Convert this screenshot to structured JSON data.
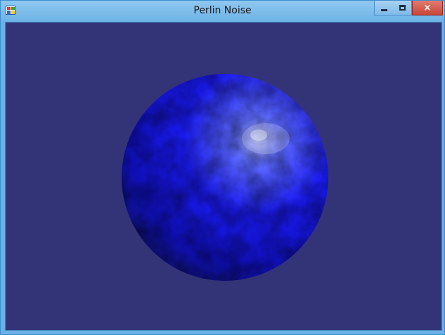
{
  "window": {
    "title": "Perlin Noise",
    "controls": {
      "minimize": "minimize",
      "maximize": "maximize",
      "close": "×"
    }
  },
  "icons": {
    "app": "app-icon",
    "minimize": "minimize-icon",
    "maximize": "maximize-icon",
    "close": "close-icon"
  },
  "colors": {
    "client_background": "#333378",
    "sphere_highlight": "#5f6dff",
    "sphere_base": "#1a1af0",
    "sphere_shadow": "#121212",
    "close_button": "#c7473a"
  }
}
